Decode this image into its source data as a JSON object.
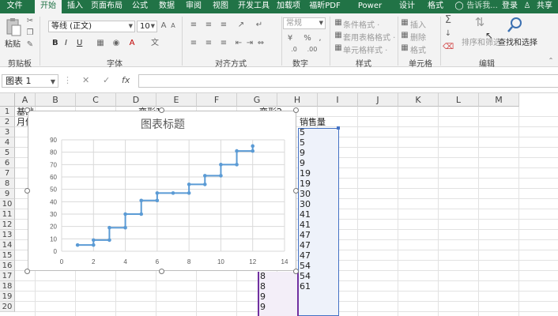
{
  "tabs": [
    "文件",
    "开始",
    "插入",
    "页面布局",
    "公式",
    "数据",
    "审阅",
    "视图",
    "开发工具",
    "加载项",
    "福昕PDF",
    "Power Pivot",
    "设计",
    "格式"
  ],
  "tellme": "告诉我...",
  "login": "登录",
  "share": "共享",
  "ribbon": {
    "paste": "粘贴",
    "font_name": "等线 (正文)",
    "font_size": "10",
    "bold": "B",
    "italic": "I",
    "underline": "U",
    "number_format": "常规",
    "conditional": "条件格式 ·",
    "table_format": "套用表格格式 ·",
    "cell_style": "单元格样式 ·",
    "insert": "插入",
    "delete": "删除",
    "format": "格式",
    "sort": "排序和筛选",
    "find": "查找和选择",
    "groups": {
      "clipboard": "剪贴板",
      "font": "字体",
      "align": "对齐方式",
      "number": "数字",
      "styles": "样式",
      "cells": "单元格",
      "edit": "编辑"
    }
  },
  "formula_bar": {
    "name_box": "图表 1",
    "cancel": "✕",
    "enter": "✓",
    "fx": "fx",
    "formula": ""
  },
  "columns": [
    "A",
    "B",
    "C",
    "D",
    "E",
    "F",
    "G",
    "H",
    "I",
    "J",
    "K",
    "L",
    "M"
  ],
  "rows": [
    "1",
    "2",
    "3",
    "4",
    "5",
    "6",
    "7",
    "8",
    "9",
    "10",
    "11",
    "12",
    "13",
    "14",
    "15",
    "16",
    "17",
    "18",
    "19",
    "20"
  ],
  "cells": {
    "A1": "基础",
    "A2": "月份",
    "D1": "变形1",
    "G1": "变形2",
    "H2": "销售量",
    "H": [
      "5",
      "5",
      "9",
      "9",
      "19",
      "19",
      "30",
      "30",
      "41",
      "41",
      "47",
      "47",
      "47",
      "54",
      "54",
      "61"
    ],
    "G": [
      "8",
      "8",
      "9",
      "9"
    ]
  },
  "chart": {
    "title": "图表标题"
  },
  "chart_data": {
    "type": "line",
    "title": "图表标题",
    "x": [
      1,
      2,
      2,
      3,
      3,
      4,
      4,
      5,
      5,
      6,
      6,
      7,
      8,
      8,
      9,
      9,
      10,
      10,
      11,
      11,
      12,
      12
    ],
    "y": [
      5,
      5,
      9,
      9,
      19,
      19,
      30,
      30,
      41,
      41,
      47,
      47,
      47,
      54,
      54,
      61,
      61,
      70,
      70,
      81,
      81,
      85
    ],
    "xlim": [
      0,
      14
    ],
    "ylim": [
      0,
      90
    ],
    "xticks": [
      0,
      2,
      4,
      6,
      8,
      10,
      12,
      14
    ],
    "yticks": [
      0,
      10,
      20,
      30,
      40,
      50,
      60,
      70,
      80,
      90
    ],
    "grid": true,
    "color": "#5b9bd5"
  },
  "colors": {
    "accent": "#217346",
    "series": "#5b9bd5",
    "selection": "#7030a0"
  }
}
